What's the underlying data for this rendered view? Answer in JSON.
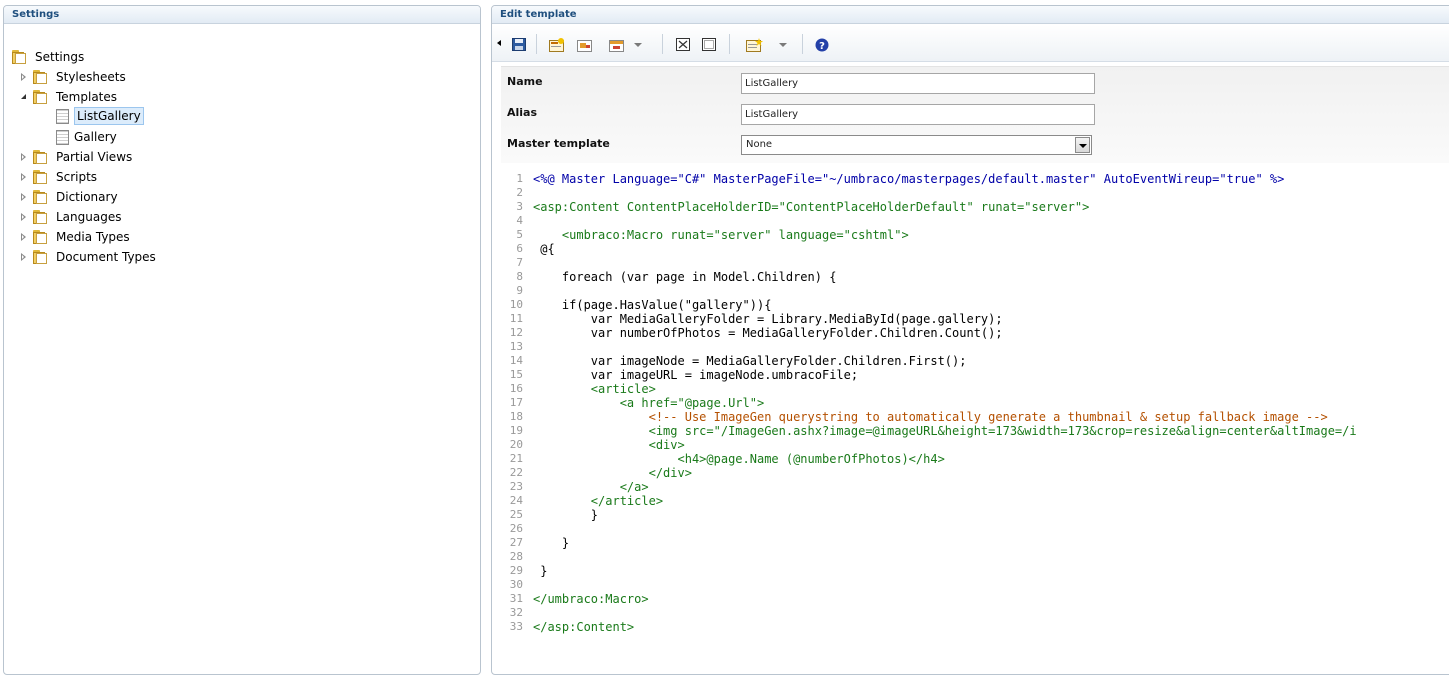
{
  "left_panel": {
    "title": "Settings",
    "tree": [
      {
        "label": "Settings",
        "icon": "folder-icon",
        "level": 0,
        "arrow": "none"
      },
      {
        "label": "Stylesheets",
        "icon": "folder-icon",
        "level": 1,
        "arrow": "collapsed"
      },
      {
        "label": "Templates",
        "icon": "folder-icon",
        "level": 1,
        "arrow": "expanded"
      },
      {
        "label": "ListGallery",
        "icon": "template-icon",
        "level": 2,
        "arrow": "none",
        "selected": true
      },
      {
        "label": "Gallery",
        "icon": "template-icon",
        "level": 2,
        "arrow": "none"
      },
      {
        "label": "Partial Views",
        "icon": "folder-icon",
        "level": 1,
        "arrow": "collapsed"
      },
      {
        "label": "Scripts",
        "icon": "folder-icon",
        "level": 1,
        "arrow": "collapsed"
      },
      {
        "label": "Dictionary",
        "icon": "folder-icon",
        "level": 1,
        "arrow": "collapsed"
      },
      {
        "label": "Languages",
        "icon": "folder-icon",
        "level": 1,
        "arrow": "collapsed"
      },
      {
        "label": "Media Types",
        "icon": "folder-icon",
        "level": 1,
        "arrow": "collapsed"
      },
      {
        "label": "Document Types",
        "icon": "folder-icon",
        "level": 1,
        "arrow": "collapsed"
      }
    ]
  },
  "right_panel": {
    "title": "Edit template",
    "toolbar": [
      "save-icon",
      "insert-field-icon",
      "insert-macro-icon",
      "insert-content-area-icon",
      "dropdown-icon",
      "insert-placeholder-icon",
      "select-all-icon",
      "insert-snippet-icon",
      "dropdown-icon",
      "help-icon"
    ],
    "form": {
      "name_label": "Name",
      "name_value": "ListGallery",
      "alias_label": "Alias",
      "alias_value": "ListGallery",
      "master_label": "Master template",
      "master_value": "None"
    },
    "code": [
      {
        "n": "1",
        "text": "<%@ Master Language=\"C#\" MasterPageFile=\"~/umbraco/masterpages/default.master\" AutoEventWireup=\"true\" %>",
        "kind": "directive"
      },
      {
        "n": "2",
        "text": "",
        "kind": "plain"
      },
      {
        "n": "3",
        "text": "<asp:Content ContentPlaceHolderID=\"ContentPlaceHolderDefault\" runat=\"server\">",
        "kind": "markup"
      },
      {
        "n": "4",
        "text": "",
        "kind": "plain"
      },
      {
        "n": "5",
        "text": "    <umbraco:Macro runat=\"server\" language=\"cshtml\">",
        "kind": "markup"
      },
      {
        "n": "6",
        "text": " @{",
        "kind": "plain"
      },
      {
        "n": "7",
        "text": "",
        "kind": "plain"
      },
      {
        "n": "8",
        "text": "    foreach (var page in Model.Children) {",
        "kind": "plain"
      },
      {
        "n": "9",
        "text": "",
        "kind": "plain"
      },
      {
        "n": "10",
        "text": "    if(page.HasValue(\"gallery\")){",
        "kind": "plain"
      },
      {
        "n": "11",
        "text": "        var MediaGalleryFolder = Library.MediaById(page.gallery);",
        "kind": "plain"
      },
      {
        "n": "12",
        "text": "        var numberOfPhotos = MediaGalleryFolder.Children.Count();",
        "kind": "plain"
      },
      {
        "n": "13",
        "text": "",
        "kind": "plain"
      },
      {
        "n": "14",
        "text": "        var imageNode = MediaGalleryFolder.Children.First();",
        "kind": "plain"
      },
      {
        "n": "15",
        "text": "        var imageURL = imageNode.umbracoFile;",
        "kind": "plain"
      },
      {
        "n": "16",
        "text": "        <article>",
        "kind": "markup"
      },
      {
        "n": "17",
        "text": "            <a href=\"@page.Url\">",
        "kind": "markup"
      },
      {
        "n": "18",
        "text": "                <!-- Use ImageGen querystring to automatically generate a thumbnail & setup fallback image -->",
        "kind": "comment"
      },
      {
        "n": "19",
        "text": "                <img src=\"/ImageGen.ashx?image=@imageURL&height=173&width=173&crop=resize&align=center&altImage=/i",
        "kind": "markup"
      },
      {
        "n": "20",
        "text": "                <div>",
        "kind": "markup"
      },
      {
        "n": "21",
        "text": "                    <h4>@page.Name (@numberOfPhotos)</h4>",
        "kind": "markup"
      },
      {
        "n": "22",
        "text": "                </div>",
        "kind": "markup"
      },
      {
        "n": "23",
        "text": "            </a>",
        "kind": "markup"
      },
      {
        "n": "24",
        "text": "        </article>",
        "kind": "markup"
      },
      {
        "n": "25",
        "text": "        }",
        "kind": "plain"
      },
      {
        "n": "26",
        "text": "",
        "kind": "plain"
      },
      {
        "n": "27",
        "text": "    }",
        "kind": "plain"
      },
      {
        "n": "28",
        "text": "",
        "kind": "plain"
      },
      {
        "n": "29",
        "text": " }",
        "kind": "plain"
      },
      {
        "n": "30",
        "text": "",
        "kind": "plain"
      },
      {
        "n": "31",
        "text": "</umbraco:Macro>",
        "kind": "markup"
      },
      {
        "n": "32",
        "text": "",
        "kind": "plain"
      },
      {
        "n": "33",
        "text": "</asp:Content>",
        "kind": "markup"
      }
    ]
  }
}
